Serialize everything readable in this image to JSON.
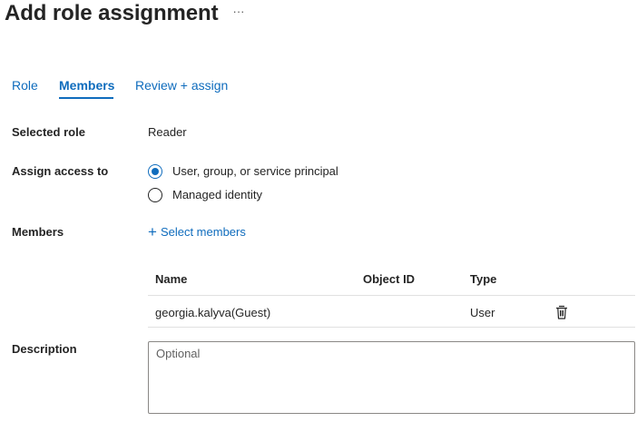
{
  "page": {
    "title": "Add role assignment",
    "more_label": "···"
  },
  "tabs": [
    {
      "label": "Role",
      "active": false
    },
    {
      "label": "Members",
      "active": true
    },
    {
      "label": "Review + assign",
      "active": false
    }
  ],
  "selected_role": {
    "label": "Selected role",
    "value": "Reader"
  },
  "assign_access": {
    "label": "Assign access to",
    "options": [
      {
        "label": "User, group, or service principal",
        "selected": true
      },
      {
        "label": "Managed identity",
        "selected": false
      }
    ]
  },
  "members": {
    "label": "Members",
    "select_link": "Select members",
    "table": {
      "columns": [
        "Name",
        "Object ID",
        "Type"
      ],
      "rows": [
        {
          "name": "georgia.kalyva(Guest)",
          "object_id": "",
          "type": "User"
        }
      ]
    }
  },
  "description": {
    "label": "Description",
    "placeholder": "Optional",
    "value": ""
  },
  "colors": {
    "accent": "#0f6cbd",
    "text": "#242424",
    "border": "#8a8886"
  },
  "icons": {
    "more": "more-horizontal-icon",
    "radio": "radio-icon",
    "plus": "plus-icon",
    "delete": "trash-icon"
  }
}
